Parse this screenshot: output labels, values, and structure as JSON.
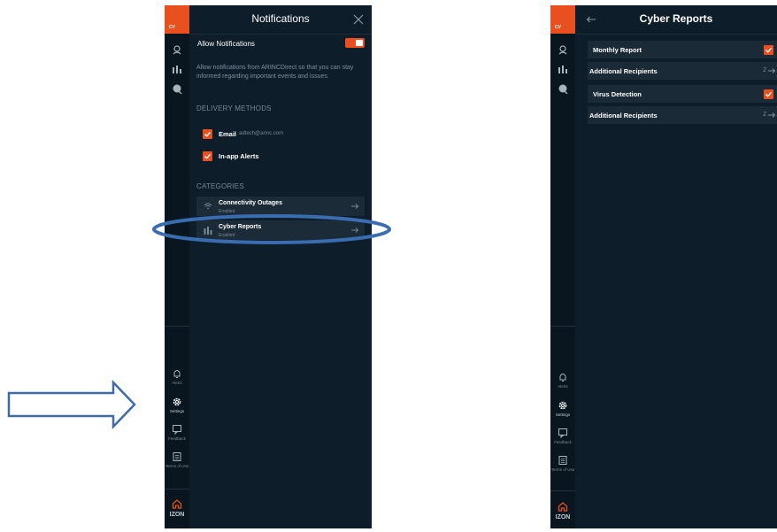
{
  "app": {
    "logo_text": "CV",
    "brand": "IZON"
  },
  "colors": {
    "accent": "#e8501f",
    "background": "#0d1d29",
    "rail": "#091620",
    "row": "#1a2a36"
  },
  "sidebar": {
    "items": [
      {
        "icon": "bell-icon",
        "label": "Alerts"
      },
      {
        "icon": "gear-icon",
        "label": "Settings"
      },
      {
        "icon": "chat-icon",
        "label": "Feedback"
      },
      {
        "icon": "document-icon",
        "label": "Terms of Use"
      }
    ]
  },
  "notifications": {
    "title": "Notifications",
    "allow_label": "Allow Notifications",
    "allow_enabled": true,
    "description": "Allow notifications from ARINCDirect so that you can stay informed regarding important events and issues.",
    "delivery_heading": "DELIVERY METHODS",
    "delivery": [
      {
        "label": "Email",
        "detail": "adtech@arinc.com",
        "checked": true
      },
      {
        "label": "In-app Alerts",
        "detail": "",
        "checked": true
      }
    ],
    "categories_heading": "CATEGORIES",
    "categories": [
      {
        "name": "Connectivity Outages",
        "status": "Enabled",
        "icon": "wifi-icon"
      },
      {
        "name": "Cyber Reports",
        "status": "Enabled",
        "icon": "chart-icon"
      }
    ]
  },
  "cyber": {
    "title": "Cyber Reports",
    "rows": [
      {
        "name": "Monthly Report",
        "type": "check",
        "checked": true
      },
      {
        "name": "Additional Recipients",
        "type": "count",
        "count": "2"
      },
      {
        "name": "Virus Detection",
        "type": "check",
        "checked": true
      },
      {
        "name": "Additional Recipients",
        "type": "count",
        "count": "2"
      }
    ]
  }
}
